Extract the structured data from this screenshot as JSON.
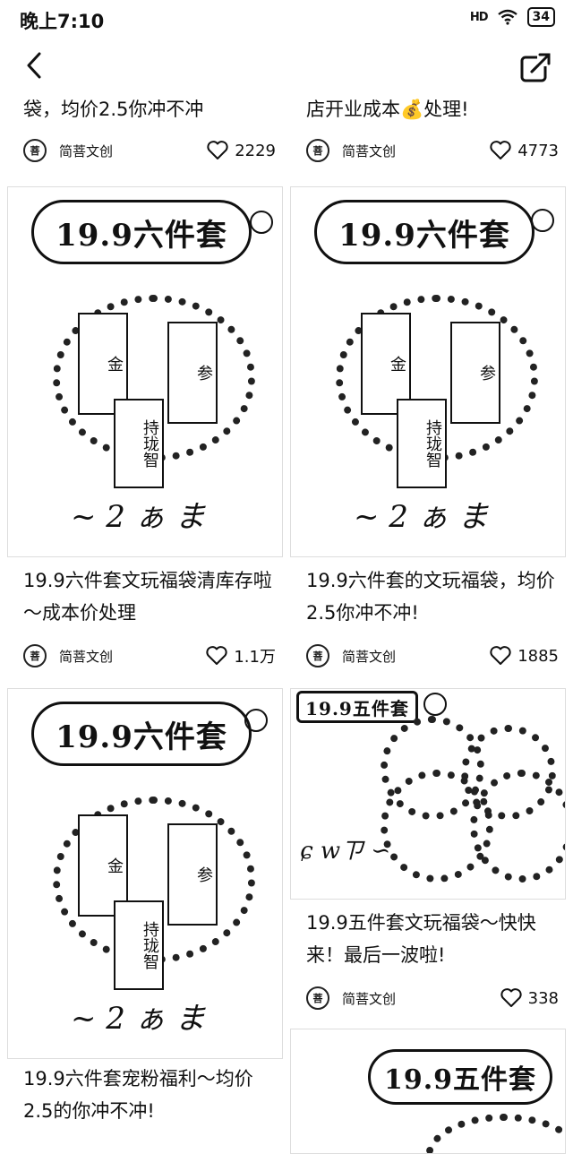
{
  "status": {
    "time": "晚上7:10",
    "signal": "HD",
    "battery": "34"
  },
  "left": [
    {
      "title": "袋，均价2.5你冲不冲",
      "author": "简菩文创",
      "likes": "2229"
    },
    {
      "badge": "19.9六件套",
      "tags": [
        "金",
        "持珑智",
        "参"
      ],
      "title": "19.9六件套文玩福袋清库存啦～成本价处理",
      "author": "简菩文创",
      "likes": "1.1万"
    },
    {
      "badge": "19.9六件套",
      "tags": [
        "金",
        "持珑智",
        "参"
      ],
      "title": "19.9六件套宠粉福利～均价2.5的你冲不冲!"
    }
  ],
  "right": [
    {
      "title": "店开业成本💰处理!",
      "author": "简菩文创",
      "likes": "4773"
    },
    {
      "badge": "19.9六件套",
      "tags": [
        "金",
        "持珑智",
        "参"
      ],
      "title": "19.9六件套的文玩福袋，均价2.5你冲不冲!",
      "author": "简菩文创",
      "likes": "1885"
    },
    {
      "badge": "19.9五件套",
      "title": "19.9五件套文玩福袋～快快来！最后一波啦!",
      "author": "简菩文创",
      "likes": "338"
    },
    {
      "badge": "19.9五件套"
    }
  ]
}
